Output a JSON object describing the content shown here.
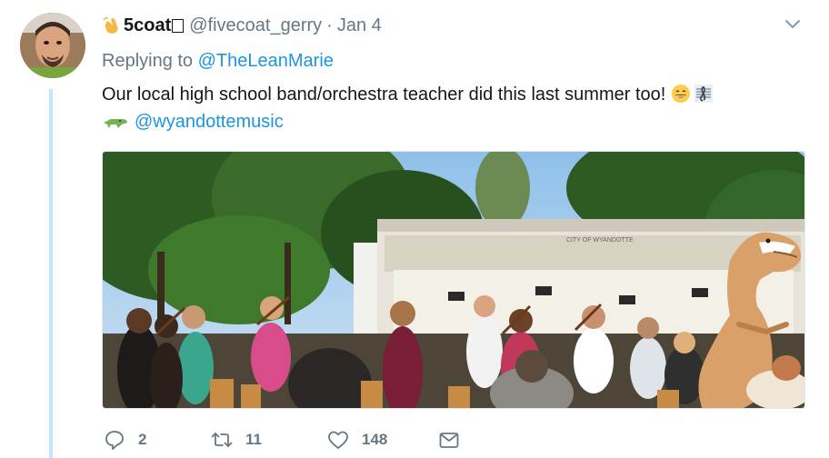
{
  "tweet": {
    "display_name": "5coat",
    "handle": "@fivecoat_gerry",
    "separator": "·",
    "date": "Jan 4",
    "replying_prefix": "Replying to",
    "replying_to": "@TheLeanMarie",
    "text": "Our local high school band/orchestra teacher did this last summer too!",
    "mention": "@wyandottemusic"
  },
  "media": {
    "sign_text": "CITY OF WYANDOTTE"
  },
  "actions": {
    "replies": "2",
    "retweets": "11",
    "likes": "148"
  },
  "icons": [
    "hand-wave-icon",
    "caret-down-icon",
    "grinning-emoji-icon",
    "musical-score-emoji-icon",
    "crocodile-emoji-icon",
    "reply-icon",
    "retweet-icon",
    "like-icon",
    "direct-message-icon"
  ],
  "colors": {
    "link": "#1b95e0",
    "muted": "#657786",
    "thread_line": "#c4e4f9"
  }
}
